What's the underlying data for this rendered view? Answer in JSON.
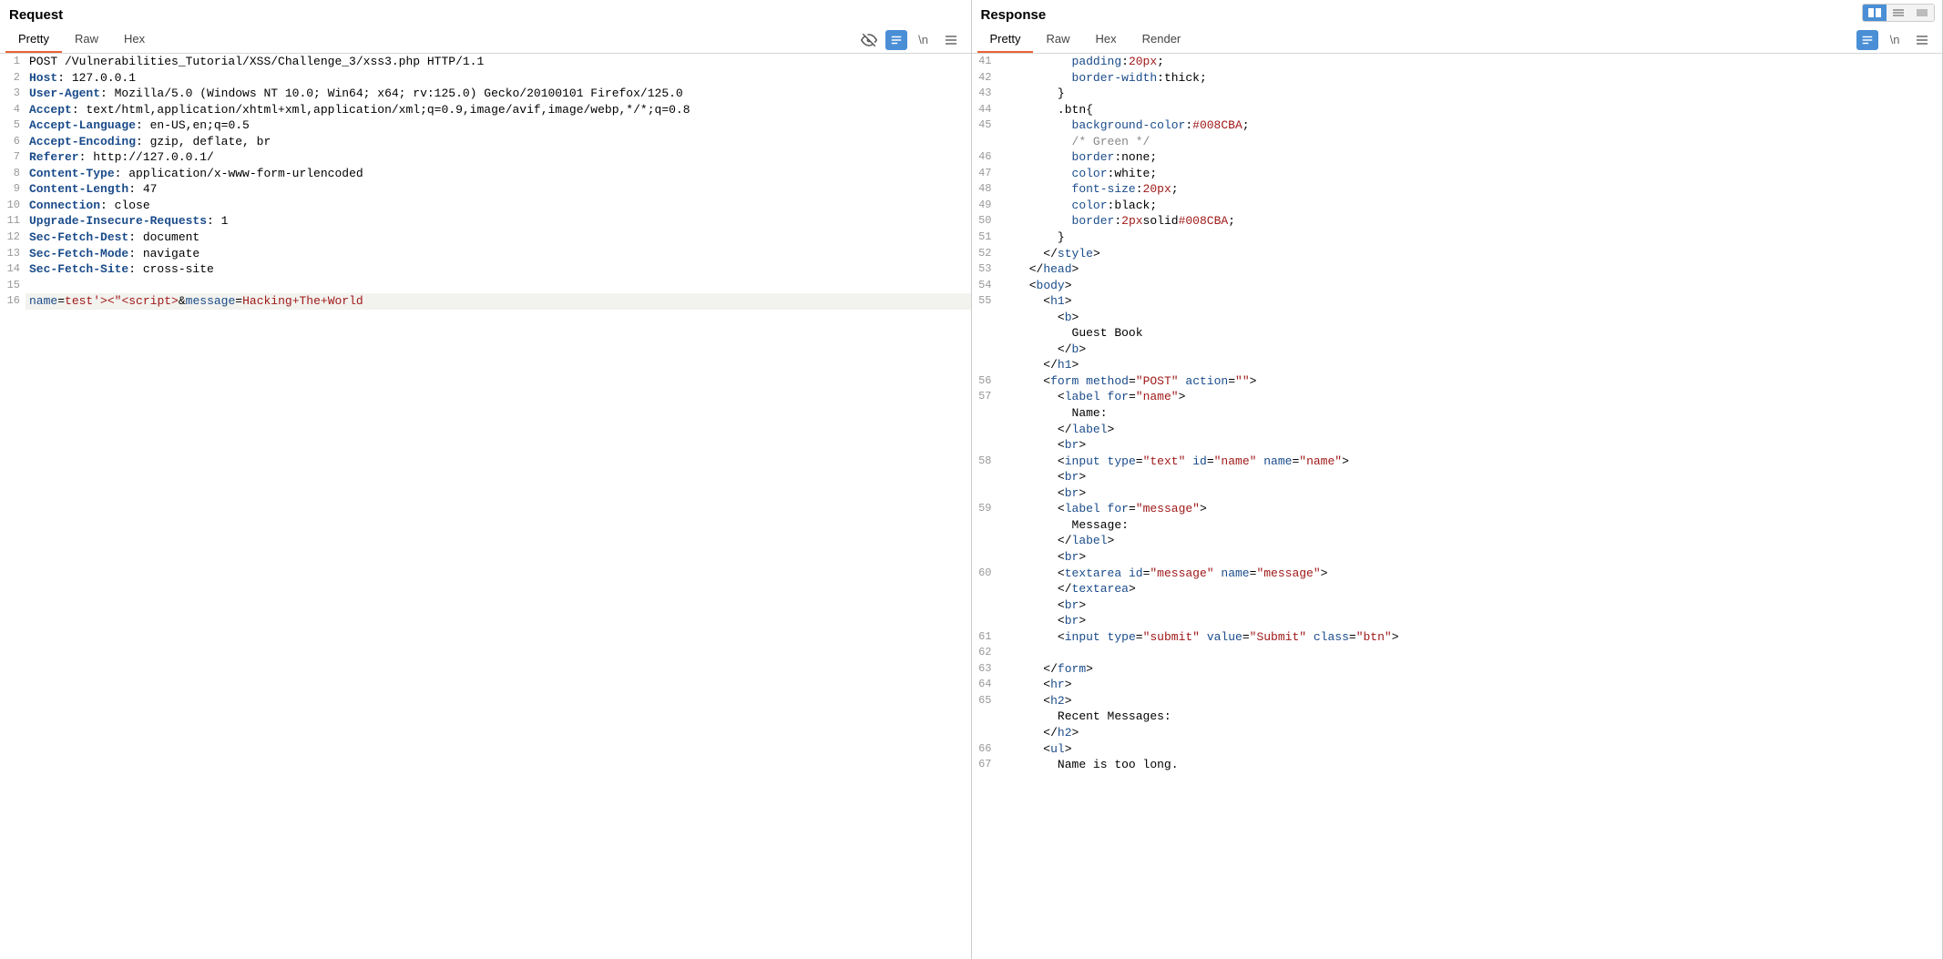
{
  "request": {
    "title": "Request",
    "tabs": [
      "Pretty",
      "Raw",
      "Hex"
    ],
    "active_tab": "Pretty",
    "lines": [
      {
        "n": 1,
        "html": "POST /Vulnerabilities_Tutorial/XSS/Challenge_3/xss3.php HTTP/1.1"
      },
      {
        "n": 2,
        "html": "<span class='k'>Host</span>: 127.0.0.1"
      },
      {
        "n": 3,
        "html": "<span class='k'>User-Agent</span>: Mozilla/5.0 (Windows NT 10.0; Win64; x64; rv:125.0) Gecko/20100101 Firefox/125.0"
      },
      {
        "n": 4,
        "html": "<span class='k'>Accept</span>: text/html,application/xhtml+xml,application/xml;q=0.9,image/avif,image/webp,*/*;q=0.8"
      },
      {
        "n": 5,
        "html": "<span class='k'>Accept-Language</span>: en-US,en;q=0.5"
      },
      {
        "n": 6,
        "html": "<span class='k'>Accept-Encoding</span>: gzip, deflate, br"
      },
      {
        "n": 7,
        "html": "<span class='k'>Referer</span>: http://127.0.0.1/"
      },
      {
        "n": 8,
        "html": "<span class='k'>Content-Type</span>: application/x-www-form-urlencoded"
      },
      {
        "n": 9,
        "html": "<span class='k'>Content-Length</span>: 47"
      },
      {
        "n": 10,
        "html": "<span class='k'>Connection</span>: close"
      },
      {
        "n": 11,
        "html": "<span class='k'>Upgrade-Insecure-Requests</span>: 1"
      },
      {
        "n": 12,
        "html": "<span class='k'>Sec-Fetch-Dest</span>: document"
      },
      {
        "n": 13,
        "html": "<span class='k'>Sec-Fetch-Mode</span>: navigate"
      },
      {
        "n": 14,
        "html": "<span class='k'>Sec-Fetch-Site</span>: cross-site"
      },
      {
        "n": 15,
        "html": ""
      },
      {
        "n": 16,
        "hl": true,
        "html": "<span class='p-name'>name</span>=<span class='p-val'>test'&gt;&lt;&quot;&lt;script&gt;</span>&amp;<span class='p-name'>message</span>=<span class='p-val'>Hacking+The+World</span>"
      }
    ]
  },
  "response": {
    "title": "Response",
    "tabs": [
      "Pretty",
      "Raw",
      "Hex",
      "Render"
    ],
    "active_tab": "Pretty",
    "lines": [
      {
        "n": 41,
        "html": "          <span class='tag'>padding</span>:<span class='val'>20px</span>;"
      },
      {
        "n": 42,
        "html": "          <span class='tag'>border-width</span>:thick;"
      },
      {
        "n": 43,
        "html": "        }"
      },
      {
        "n": 44,
        "html": "        .btn{"
      },
      {
        "n": 45,
        "html": "          <span class='tag'>background-color</span>:<span class='val'>#008CBA</span>;"
      },
      {
        "n": "",
        "html": "          <span class='comment'>/* Green */</span>"
      },
      {
        "n": 46,
        "html": "          <span class='tag'>border</span>:none;"
      },
      {
        "n": 47,
        "html": "          <span class='tag'>color</span>:white;"
      },
      {
        "n": 48,
        "html": "          <span class='tag'>font-size</span>:<span class='val'>20px</span>;"
      },
      {
        "n": 49,
        "html": "          <span class='tag'>color</span>:black;"
      },
      {
        "n": 50,
        "html": "          <span class='tag'>border</span>:<span class='val'>2px</span>solid<span class='val'>#008CBA</span>;"
      },
      {
        "n": 51,
        "html": "        }"
      },
      {
        "n": 52,
        "html": "      &lt;/<span class='tag'>style</span>&gt;"
      },
      {
        "n": 53,
        "html": "    &lt;/<span class='tag'>head</span>&gt;"
      },
      {
        "n": 54,
        "html": "    &lt;<span class='tag'>body</span>&gt;"
      },
      {
        "n": 55,
        "html": "      &lt;<span class='tag'>h1</span>&gt;"
      },
      {
        "n": "",
        "html": "        &lt;<span class='tag'>b</span>&gt;"
      },
      {
        "n": "",
        "html": "          Guest Book"
      },
      {
        "n": "",
        "html": "        &lt;/<span class='tag'>b</span>&gt;"
      },
      {
        "n": "",
        "html": "      &lt;/<span class='tag'>h1</span>&gt;"
      },
      {
        "n": 56,
        "html": "      &lt;<span class='tag'>form</span> <span class='attr'>method</span>=<span class='val'>&quot;POST&quot;</span> <span class='attr'>action</span>=<span class='val'>&quot;&quot;</span>&gt;"
      },
      {
        "n": 57,
        "html": "        &lt;<span class='tag'>label</span> <span class='attr'>for</span>=<span class='val'>&quot;name&quot;</span>&gt;"
      },
      {
        "n": "",
        "html": "          Name:"
      },
      {
        "n": "",
        "html": "        &lt;/<span class='tag'>label</span>&gt;"
      },
      {
        "n": "",
        "html": "        &lt;<span class='tag'>br</span>&gt;"
      },
      {
        "n": 58,
        "html": "        &lt;<span class='tag'>input</span> <span class='attr'>type</span>=<span class='val'>&quot;text&quot;</span> <span class='attr'>id</span>=<span class='val'>&quot;name&quot;</span> <span class='attr'>name</span>=<span class='val'>&quot;name&quot;</span>&gt;"
      },
      {
        "n": "",
        "html": "        &lt;<span class='tag'>br</span>&gt;"
      },
      {
        "n": "",
        "html": "        &lt;<span class='tag'>br</span>&gt;"
      },
      {
        "n": 59,
        "html": "        &lt;<span class='tag'>label</span> <span class='attr'>for</span>=<span class='val'>&quot;message&quot;</span>&gt;"
      },
      {
        "n": "",
        "html": "          Message:"
      },
      {
        "n": "",
        "html": "        &lt;/<span class='tag'>label</span>&gt;"
      },
      {
        "n": "",
        "html": "        &lt;<span class='tag'>br</span>&gt;"
      },
      {
        "n": 60,
        "html": "        &lt;<span class='tag'>textarea</span> <span class='attr'>id</span>=<span class='val'>&quot;message&quot;</span> <span class='attr'>name</span>=<span class='val'>&quot;message&quot;</span>&gt;"
      },
      {
        "n": "",
        "html": "        &lt;/<span class='tag'>textarea</span>&gt;"
      },
      {
        "n": "",
        "html": "        &lt;<span class='tag'>br</span>&gt;"
      },
      {
        "n": "",
        "html": "        &lt;<span class='tag'>br</span>&gt;"
      },
      {
        "n": 61,
        "html": "        &lt;<span class='tag'>input</span> <span class='attr'>type</span>=<span class='val'>&quot;submit&quot;</span> <span class='attr'>value</span>=<span class='val'>&quot;Submit&quot;</span> <span class='attr'>class</span>=<span class='val'>&quot;btn&quot;</span>&gt;"
      },
      {
        "n": 62,
        "html": ""
      },
      {
        "n": 63,
        "html": "      &lt;/<span class='tag'>form</span>&gt;"
      },
      {
        "n": 64,
        "html": "      &lt;<span class='tag'>hr</span>&gt;"
      },
      {
        "n": 65,
        "html": "      &lt;<span class='tag'>h2</span>&gt;"
      },
      {
        "n": "",
        "html": "        Recent Messages:"
      },
      {
        "n": "",
        "html": "      &lt;/<span class='tag'>h2</span>&gt;"
      },
      {
        "n": 66,
        "html": "      &lt;<span class='tag'>ul</span>&gt;"
      },
      {
        "n": 67,
        "html": "        Name is too long."
      }
    ]
  }
}
